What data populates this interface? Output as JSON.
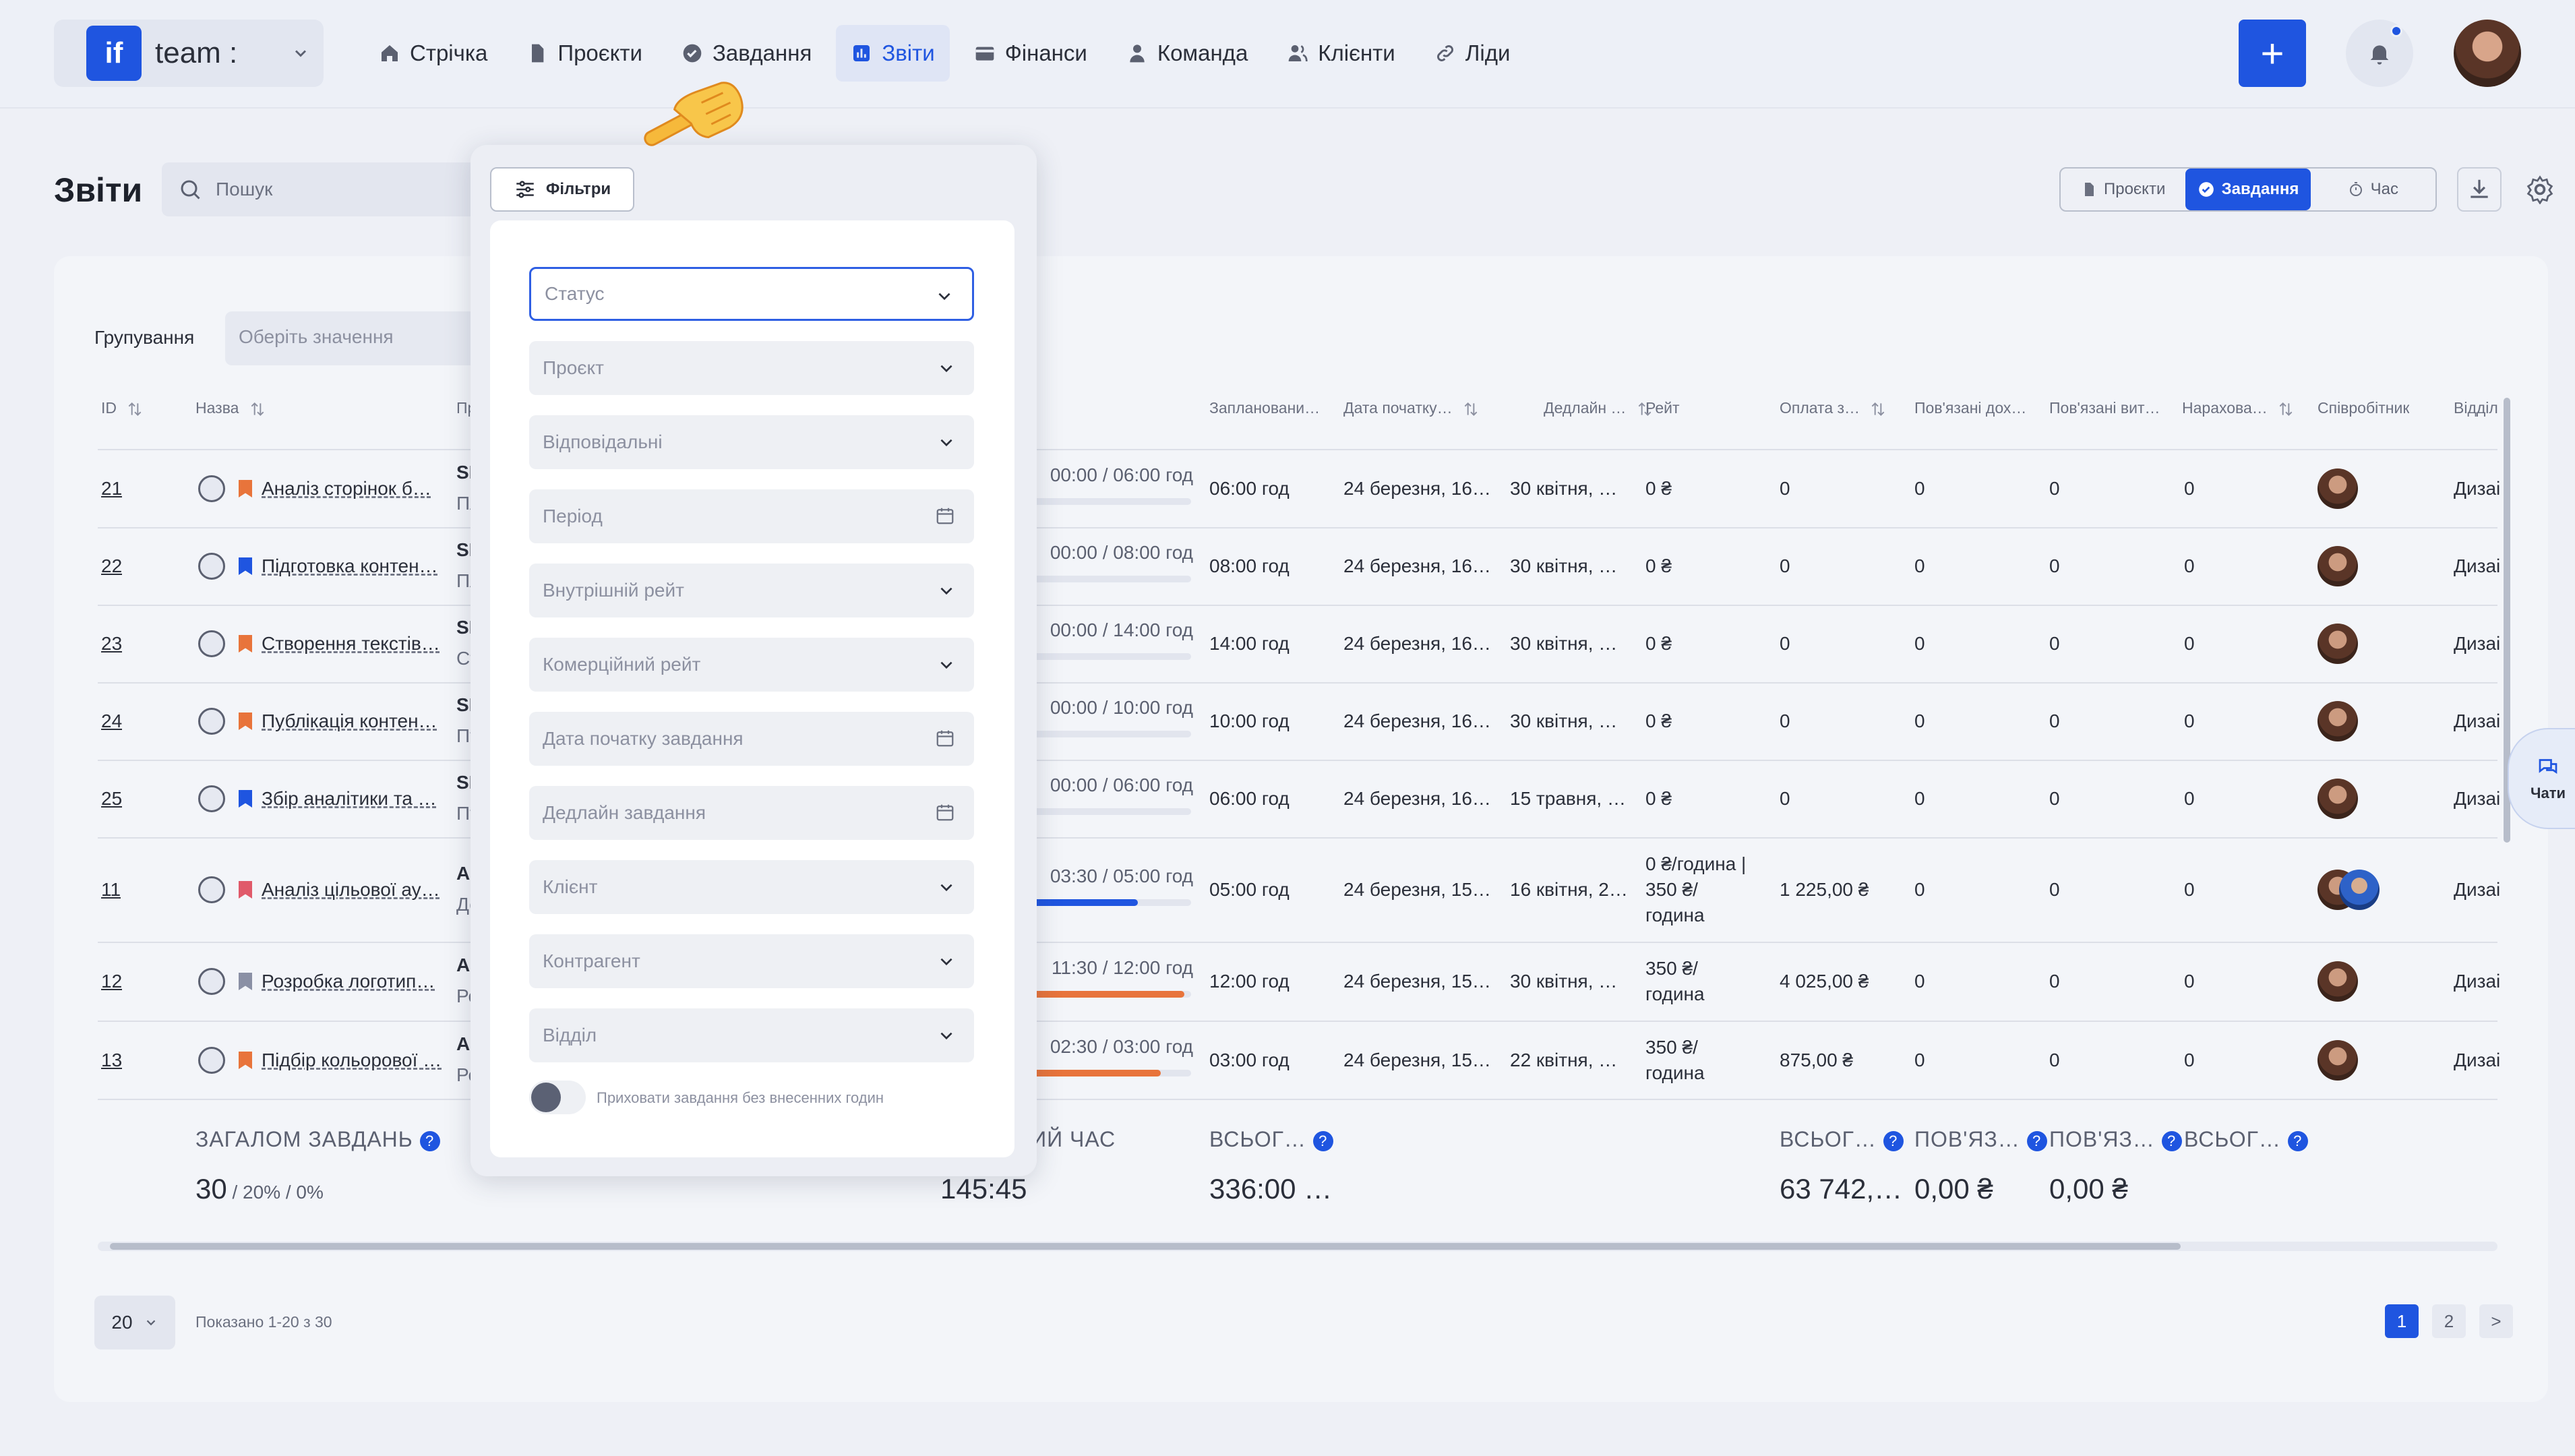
{
  "brand": {
    "logo": "if",
    "name": "team :"
  },
  "nav": [
    {
      "label": "Стрічка",
      "icon": "home-icon"
    },
    {
      "label": "Проєкти",
      "icon": "document-icon"
    },
    {
      "label": "Завдання",
      "icon": "check-circle-icon"
    },
    {
      "label": "Звіти",
      "icon": "report-icon",
      "active": true
    },
    {
      "label": "Фінанси",
      "icon": "wallet-icon"
    },
    {
      "label": "Команда",
      "icon": "person-icon"
    },
    {
      "label": "Клієнти",
      "icon": "people-icon"
    },
    {
      "label": "Ліди",
      "icon": "link-icon"
    }
  ],
  "header": {
    "title": "Звіти",
    "search_placeholder": "Пошук",
    "add_label": "+",
    "views": [
      "Проєкти",
      "Завдання",
      "Час"
    ],
    "active_view": "Завдання"
  },
  "filters": {
    "button_label": "Фільтри",
    "fields": [
      "Статус",
      "Проєкт",
      "Відповідальні",
      "Період",
      "Внутрішній рейт",
      "Комерційний рейт",
      "Дата початку завдання",
      "Дедлайн завдання",
      "Клієнт",
      "Контрагент",
      "Відділ"
    ],
    "toggle_label": "Приховати завдання без внесенних годин"
  },
  "grouping": {
    "label": "Групування",
    "placeholder": "Оберіть значення"
  },
  "table": {
    "headers": {
      "id": "ID",
      "name": "Назва",
      "project": "Про",
      "planned": "Заплановани…",
      "start": "Дата початку…",
      "deadline": "Дедлайн …",
      "rate": "Рейт",
      "payment": "Оплата з…",
      "linked_income": "Пов'язані дох…",
      "linked_expense": "Пов'язані вит…",
      "accrued": "Нарахова…",
      "employee": "Співробітник",
      "dept": "Відділ"
    },
    "rows": [
      {
        "id": "21",
        "flag": "#e8743b",
        "name": "Аналіз сторінок б…",
        "project": "SMM",
        "sub": "Пла",
        "time": "00:00 / 06:00 год",
        "progress": 0,
        "planned": "06:00 год",
        "start": "24 березня, 16…",
        "deadline": "30 квітня, …",
        "rate": [
          "0 ₴"
        ],
        "payment": "0",
        "income": "0",
        "expense": "0",
        "accrued": "0",
        "dept": "Дизаі"
      },
      {
        "id": "22",
        "flag": "#1f55e0",
        "name": "Підготовка контен…",
        "project": "SMM",
        "sub": "Пла",
        "time": "00:00 / 08:00 год",
        "progress": 0,
        "planned": "08:00 год",
        "start": "24 березня, 16…",
        "deadline": "30 квітня, …",
        "rate": [
          "0 ₴"
        ],
        "payment": "0",
        "income": "0",
        "expense": "0",
        "accrued": "0",
        "dept": "Дизаі"
      },
      {
        "id": "23",
        "flag": "#e8743b",
        "name": "Створення текстів…",
        "project": "SMM",
        "sub": "Ств",
        "time": "00:00 / 14:00 год",
        "progress": 0,
        "planned": "14:00 год",
        "start": "24 березня, 16…",
        "deadline": "30 квітня, …",
        "rate": [
          "0 ₴"
        ],
        "payment": "0",
        "income": "0",
        "expense": "0",
        "accrued": "0",
        "dept": "Дизаі"
      },
      {
        "id": "24",
        "flag": "#e8743b",
        "name": "Публікація контен…",
        "project": "SMM",
        "sub": "Пуб",
        "time": "00:00 / 10:00 год",
        "progress": 0,
        "planned": "10:00 год",
        "start": "24 березня, 16…",
        "deadline": "30 квітня, …",
        "rate": [
          "0 ₴"
        ],
        "payment": "0",
        "income": "0",
        "expense": "0",
        "accrued": "0",
        "dept": "Дизаі"
      },
      {
        "id": "25",
        "flag": "#1f55e0",
        "name": "Збір аналітики та …",
        "project": "SMM",
        "sub": "Пуб",
        "time": "00:00 / 06:00 год",
        "progress": 0,
        "planned": "06:00 год",
        "start": "24 березня, 16…",
        "deadline": "15 травня, …",
        "rate": [
          "0 ₴"
        ],
        "payment": "0",
        "income": "0",
        "expense": "0",
        "accrued": "0",
        "dept": "Дизаі"
      },
      {
        "id": "11",
        "flag": "#e05a6a",
        "name": "Аналіз цільової ау…",
        "project": "Айд",
        "sub": "Дос",
        "time": "03:30 / 05:00 год",
        "progress": 0.7,
        "bar": "#1f55e0",
        "planned": "05:00 год",
        "start": "24 березня, 15…",
        "deadline": "16 квітня, 2…",
        "rate": [
          "0 ₴/година |",
          "350 ₴/",
          "година"
        ],
        "payment": "1 225,00 ₴",
        "income": "0",
        "expense": "0",
        "accrued": "0",
        "dept": "Дизаі",
        "two_avatars": true
      },
      {
        "id": "12",
        "flag": "#8a90a5",
        "name": "Розробка логотип…",
        "project": "Айд",
        "sub": "Роз",
        "time": "11:30 / 12:00 год",
        "progress": 0.96,
        "bar": "#e8743b",
        "planned": "12:00 год",
        "start": "24 березня, 15…",
        "deadline": "30 квітня, …",
        "rate": [
          "350 ₴/",
          "година"
        ],
        "payment": "4 025,00 ₴",
        "income": "0",
        "expense": "0",
        "accrued": "0",
        "dept": "Дизаі"
      },
      {
        "id": "13",
        "flag": "#e8743b",
        "name": "Підбір кольорової …",
        "project": "Айд",
        "sub": "Роз",
        "time": "02:30 / 03:00 год",
        "progress": 0.83,
        "bar": "#e8743b",
        "planned": "03:00 год",
        "start": "24 березня, 15…",
        "deadline": "22 квітня, …",
        "rate": [
          "350 ₴/",
          "година"
        ],
        "payment": "875,00 ₴",
        "income": "0",
        "expense": "0",
        "accrued": "0",
        "dept": "Дизаі"
      }
    ]
  },
  "totals": {
    "tasks_label": "ЗАГАЛОМ ЗАВДАНЬ",
    "tasks_value": "30",
    "tasks_sub": " / 20% / 0%",
    "time_label": "НИЙ ЧАС",
    "time_value": "145:45",
    "planned_label": "ВСЬОГ…",
    "planned_value": "336:00 …",
    "payment_label": "ВСЬОГ…",
    "payment_value": "63 742,…",
    "income_label": "ПОВ'ЯЗ…",
    "income_value": "0,00 ₴",
    "expense_label": "ПОВ'ЯЗ…",
    "expense_value": "0,00 ₴",
    "accrued_label": "ВСЬОГ…",
    "help": "?"
  },
  "pagination": {
    "per_page": "20",
    "shown": "Показано 1-20 з 30",
    "pages": [
      "1",
      "2"
    ],
    "current": "1",
    "next": ">"
  },
  "chats": {
    "label": "Чати"
  },
  "colors": {
    "accent": "#1f55e0",
    "orange": "#e8743b",
    "background": "#eef0f6"
  }
}
